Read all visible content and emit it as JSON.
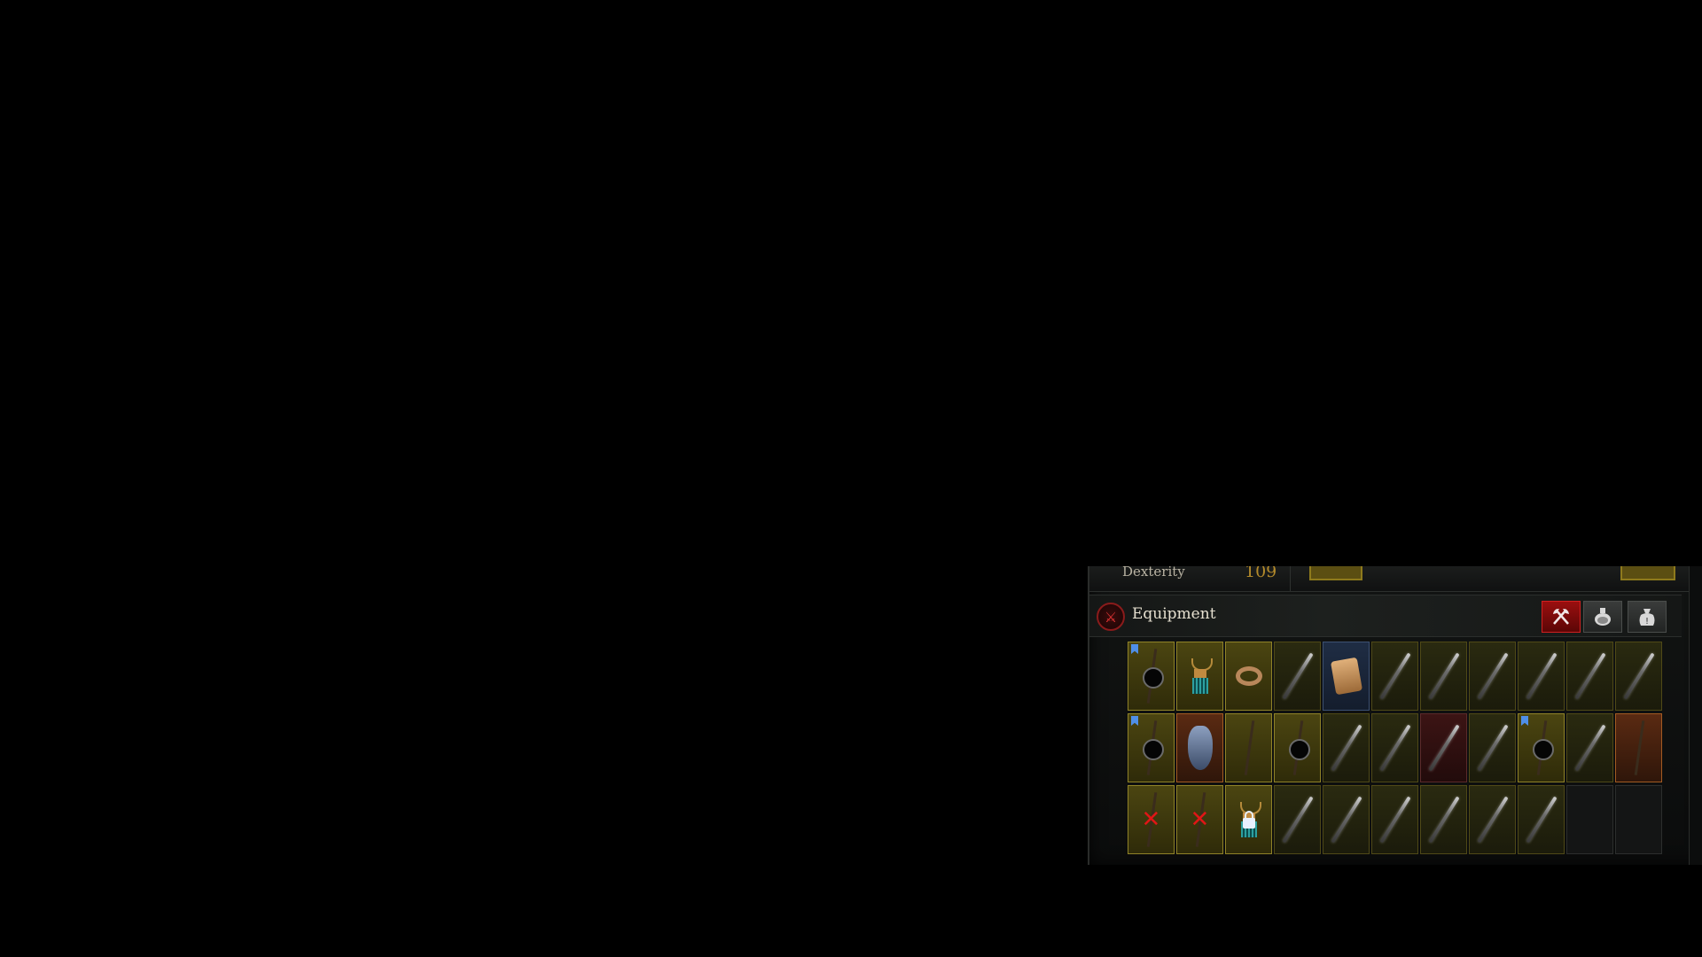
{
  "stats": {
    "label": "Dexterity",
    "value": "109"
  },
  "header": {
    "title": "Equipment"
  },
  "tabs": [
    {
      "name": "equipment-tab",
      "icon": "axe-icon",
      "active": true
    },
    {
      "name": "consumables-tab",
      "icon": "potion-icon",
      "active": false
    },
    {
      "name": "quest-items-tab",
      "icon": "bag-icon",
      "active": false
    }
  ],
  "inventory": {
    "rows": [
      [
        {
          "rarity": "rare",
          "icon": "socket-icon",
          "marked": true
        },
        {
          "rarity": "rare",
          "icon": "amulet-icon"
        },
        {
          "rarity": "rare",
          "icon": "ring-icon"
        },
        {
          "rarity": "dim",
          "icon": "blade-icon"
        },
        {
          "rarity": "magic",
          "icon": "scroll-icon"
        },
        {
          "rarity": "dim",
          "icon": "blade-icon"
        },
        {
          "rarity": "dim",
          "icon": "blade-icon"
        },
        {
          "rarity": "dim",
          "icon": "blade-icon"
        },
        {
          "rarity": "dim",
          "icon": "blade-icon"
        },
        {
          "rarity": "dim",
          "icon": "blade-icon"
        },
        {
          "rarity": "dim",
          "icon": "blade-icon"
        }
      ],
      [
        {
          "rarity": "rare",
          "icon": "socket-icon",
          "marked": true
        },
        {
          "rarity": "legendary",
          "icon": "shield-icon"
        },
        {
          "rarity": "rare",
          "icon": "staff-icon"
        },
        {
          "rarity": "rare",
          "icon": "socket-icon"
        },
        {
          "rarity": "dim",
          "icon": "blade-icon"
        },
        {
          "rarity": "dim",
          "icon": "blade-icon"
        },
        {
          "rarity": "red",
          "icon": "blade-icon"
        },
        {
          "rarity": "dim",
          "icon": "blade-icon"
        },
        {
          "rarity": "rare",
          "icon": "socket-icon",
          "marked": true
        },
        {
          "rarity": "dim",
          "icon": "blade-icon"
        },
        {
          "rarity": "legendary",
          "icon": "staff-icon"
        }
      ],
      [
        {
          "rarity": "rare",
          "icon": "x-icon"
        },
        {
          "rarity": "rare",
          "icon": "x-icon"
        },
        {
          "rarity": "rare",
          "icon": "locked-amulet-icon"
        },
        {
          "rarity": "dim",
          "icon": "blade-icon"
        },
        {
          "rarity": "dim",
          "icon": "blade-icon"
        },
        {
          "rarity": "dim",
          "icon": "blade-icon"
        },
        {
          "rarity": "dim",
          "icon": "blade-icon"
        },
        {
          "rarity": "dim",
          "icon": "blade-icon"
        },
        {
          "rarity": "dim",
          "icon": "blade-icon"
        },
        {
          "rarity": "empty",
          "icon": ""
        },
        {
          "rarity": "empty",
          "icon": ""
        }
      ]
    ]
  },
  "colors": {
    "accent_red": "#c01010",
    "rare_gold": "#8f8228",
    "magic_blue": "#3c5072"
  }
}
